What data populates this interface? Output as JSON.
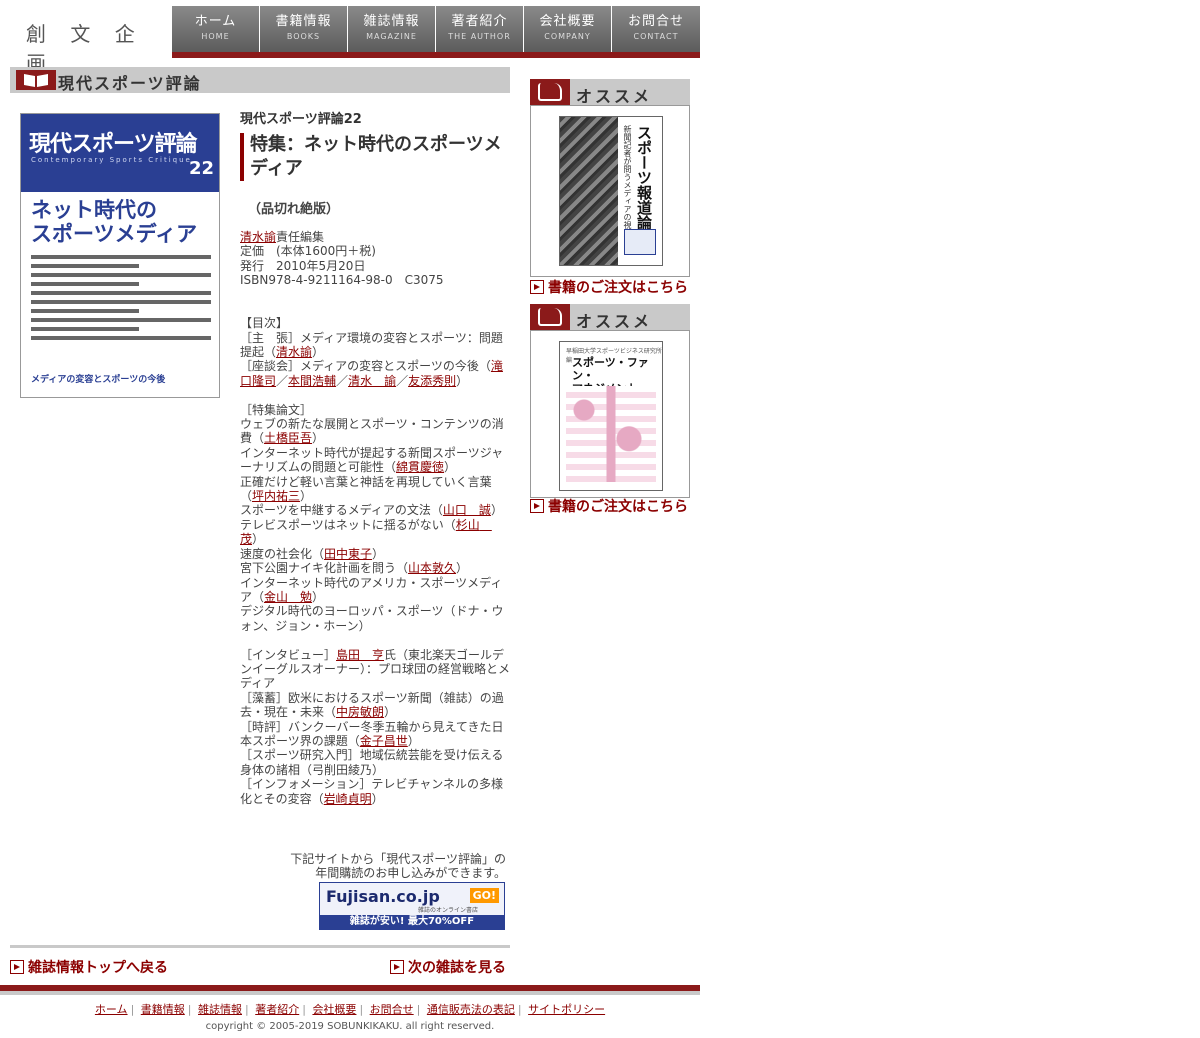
{
  "header": {
    "logo": "創 文 企 画",
    "nav": [
      {
        "jp": "ホーム",
        "en": "HOME"
      },
      {
        "jp": "書籍情報",
        "en": "BOOKS"
      },
      {
        "jp": "雑誌情報",
        "en": "MAGAZINE"
      },
      {
        "jp": "著者紹介",
        "en": "THE AUTHOR"
      },
      {
        "jp": "会社概要",
        "en": "COMPANY"
      },
      {
        "jp": "お問合せ",
        "en": "CONTACT"
      }
    ]
  },
  "section_title": "現代スポーツ評論",
  "cover": {
    "title": "現代スポーツ評論",
    "en": "Contemporary Sports Critique",
    "number": "22",
    "main": "ネット時代の\nスポーツメディア",
    "sub": "メディアの変容とスポーツの今後"
  },
  "magazine": {
    "name": "現代スポーツ評論22",
    "feature": "特集：ネット時代のスポーツメディア",
    "status": "（品切れ絶版）",
    "editor": "清水諭",
    "editor_suffix": "責任編集",
    "price": "定価　(本体1600円＋税)",
    "date": "発行　2010年5月20日",
    "isbn": "ISBN978-4-9211164-98-0　C3075"
  },
  "toc": {
    "heading": "【目次】",
    "s1_1a": "［主　張］メディア環境の変容とスポーツ：問題提起（",
    "s1_1b": "清水諭",
    "s1_2a": "［座談会］メディアの変容とスポーツの今後",
    "s1_2p": "（",
    "s1_2b": "滝口隆司",
    "s1_2c": "本間浩輔",
    "s1_2d": "清水　諭",
    "s1_2e": "友添秀則",
    "sep": "／",
    "close": "）",
    "s2_head": "［特集論文］",
    "s2_1a": "ウェブの新たな展開とスポーツ・コンテンツの消費（",
    "s2_1b": "土橋臣吾",
    "s2_2a": "インターネット時代が提起する新聞スポーツジャーナリズムの問題と可能性（",
    "s2_2b": "綿貫慶徳",
    "s2_3a": "正確だけど軽い言葉と神話を再現していく言葉（",
    "s2_3b": "坪内祐三",
    "s2_4a": "スポーツを中継するメディアの文法（",
    "s2_4b": "山口　誠",
    "s2_5a": "テレビスポーツはネットに揺るがない（",
    "s2_5b": "杉山　茂",
    "s2_6a": "速度の社会化（",
    "s2_6b": "田中東子",
    "s2_7a": "宮下公園ナイキ化計画を問う（",
    "s2_7b": "山本敦久",
    "s2_8a": "インターネット時代のアメリカ・スポーツメディア（",
    "s2_8b": "金山　勉",
    "s2_9": "デジタル時代のヨーロッパ・スポーツ（ドナ・ウォン、ジョン・ホーン）",
    "s3_1a": "［インタビュー］",
    "s3_1b": "島田　亨",
    "s3_1c": "氏（東北楽天ゴールデンイーグルスオーナー）：プロ球団の経営戦略とメディア",
    "s3_2a": "［藻蓄］欧米におけるスポーツ新聞（雑誌）の過去・現在・未来（",
    "s3_2b": "中房敏朗",
    "s3_3a": "［時評］バンクーバー冬季五輪から見えてきた日本スポーツ界の課題（",
    "s3_3b": "金子昌世",
    "s3_4": "［スポーツ研究入門］地域伝統芸能を受け伝える身体の諸相（弓削田綾乃）",
    "s3_5a": "［インフォメーション］テレビチャンネルの多様化とその変容（",
    "s3_5b": "岩崎貞明"
  },
  "subscription": {
    "text1": "下記サイトから「現代スポーツ評論」の",
    "text2": "年間購読のお申し込みができます。",
    "banner_logo": "Fujisan.co.jp",
    "banner_go": "GO!",
    "banner_sub": "雑誌のオンライン書店",
    "banner_bottom": "雑誌が安い! 最大70%OFF"
  },
  "bottom_nav": {
    "back": "雑誌情報トップへ戻る",
    "next": "次の雑誌を見る"
  },
  "sidebar": {
    "heading": "オススメ",
    "order": "書籍のご注文はこちら",
    "book1_title": "スポーツ報道論",
    "book1_sub": "新聞記者が問うメディアの視点",
    "book2_top": "早稲田大学スポーツビジネス研究所 編",
    "book2_title": "スポーツ・ファン・\nマネジメント"
  },
  "footer": {
    "links": [
      "ホーム",
      "書籍情報",
      "雑誌情報",
      "著者紹介",
      "会社概要",
      "お問合せ",
      "通信販売法の表記",
      "サイトポリシー"
    ],
    "copyright": "copyright © 2005-2019 SOBUNKIKAKU. all right reserved."
  },
  "colors": {
    "accent": "#8b1a1a",
    "link": "#8b0000",
    "nav": "#6f6f6f",
    "panel": "#c9c9c9",
    "cover_blue": "#2a3f93"
  }
}
